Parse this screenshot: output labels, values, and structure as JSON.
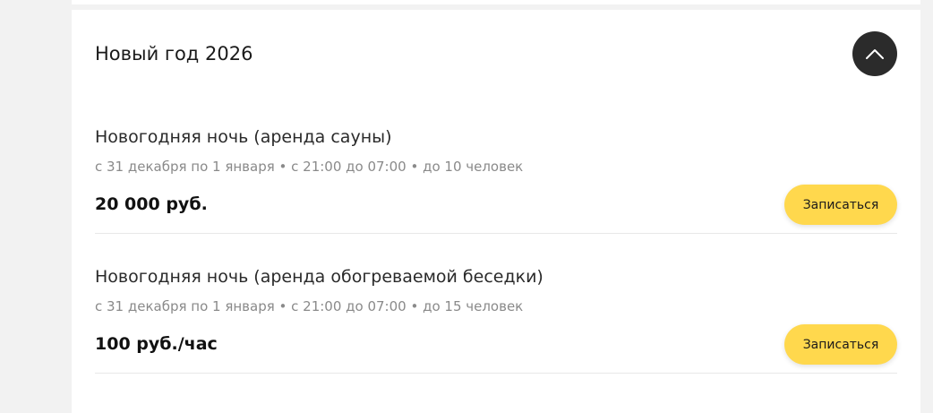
{
  "section": {
    "title": "Новый год 2026",
    "toggle_icon": "chevron-up-icon"
  },
  "services": [
    {
      "name": "Новогодняя ночь (аренда сауны)",
      "meta": "с 31 декабря по 1 января • с 21:00 до 07:00 • до 10 человек",
      "price": "20 000 руб.",
      "button_label": "Записаться"
    },
    {
      "name": "Новогодняя ночь (аренда обогреваемой беседки)",
      "meta": "с 31 декабря по 1 января • с 21:00 до 07:00 • до 15 человек",
      "price": "100 руб./час",
      "button_label": "Записаться"
    }
  ],
  "colors": {
    "page_background": "#f2f2f2",
    "card_background": "#ffffff",
    "button_accent": "#ffd84d",
    "toggle_background": "#2b2b2b",
    "meta_text": "#8a8a8a"
  }
}
